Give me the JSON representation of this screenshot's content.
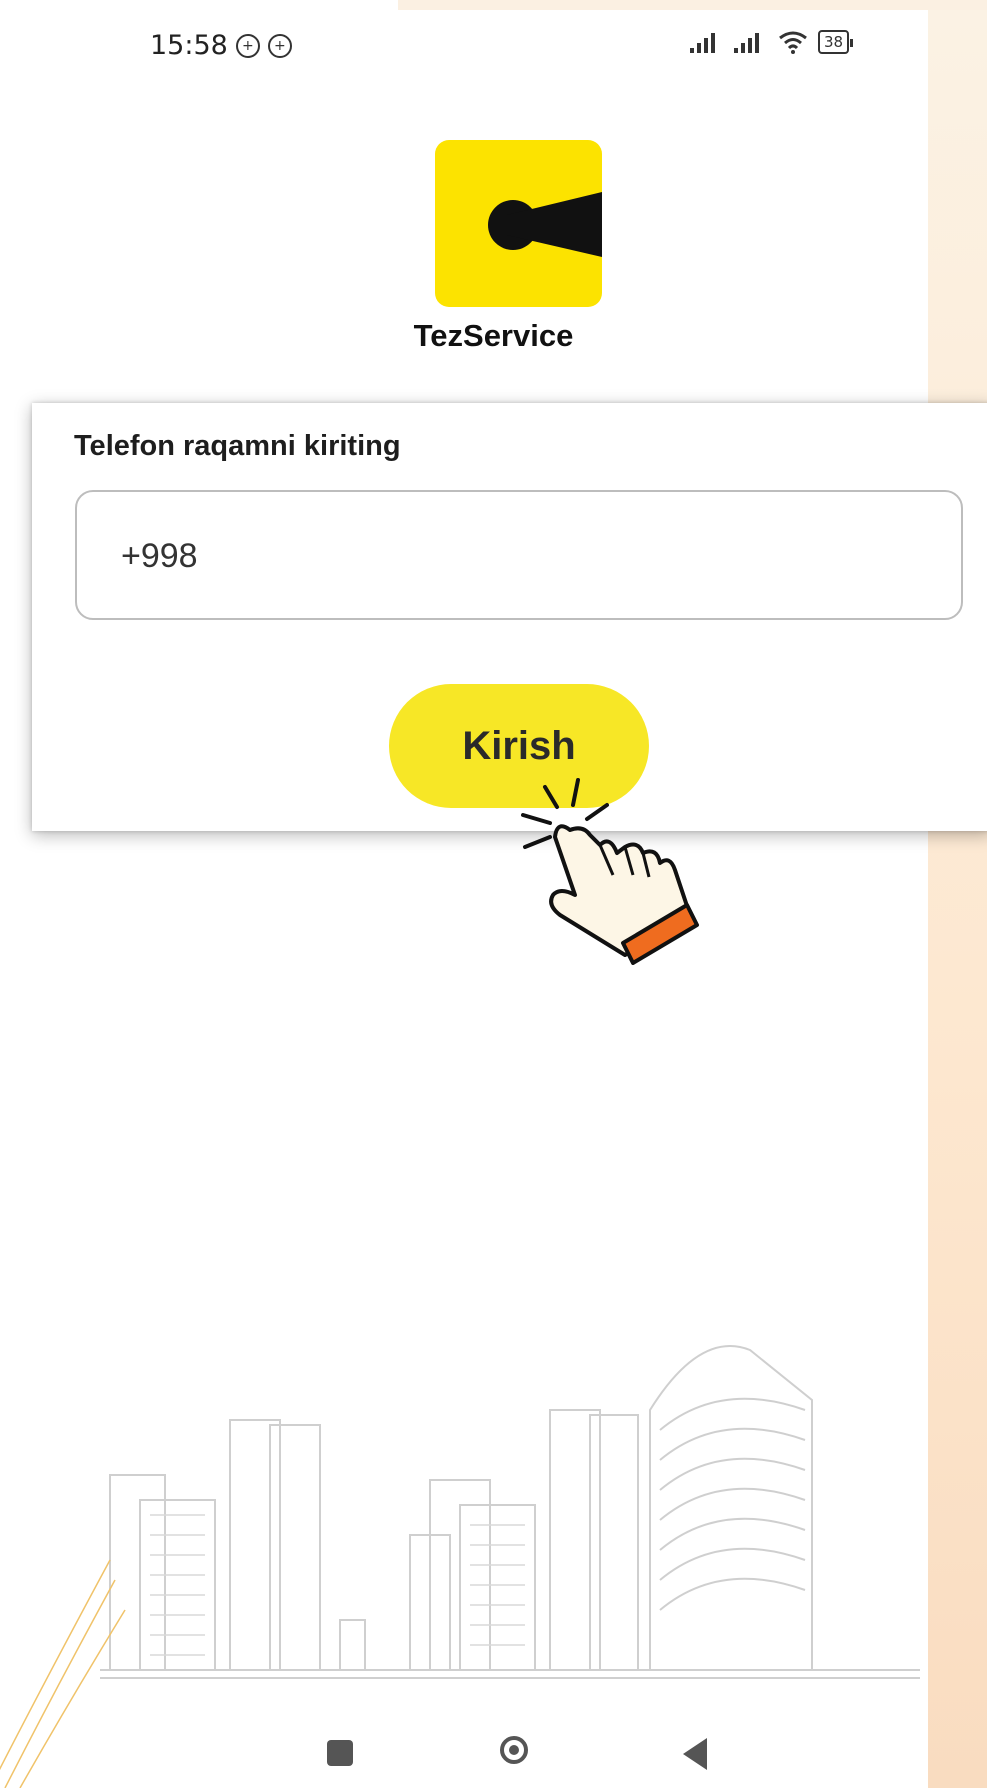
{
  "status_bar": {
    "time": "15:58",
    "battery": "38",
    "notification_icons": [
      "location-icon",
      "location-icon"
    ],
    "right_icons": [
      "signal-icon",
      "signal-icon",
      "wifi-icon",
      "battery-icon"
    ]
  },
  "app": {
    "name": "TezService",
    "brand_color": "#fce300"
  },
  "form": {
    "label": "Telefon raqamni kiriting",
    "phone_value": "+998",
    "submit_label": "Kirish",
    "button_color": "#f7e726"
  },
  "nav_bar": {
    "items": [
      "recents-button",
      "home-button",
      "back-button"
    ]
  }
}
